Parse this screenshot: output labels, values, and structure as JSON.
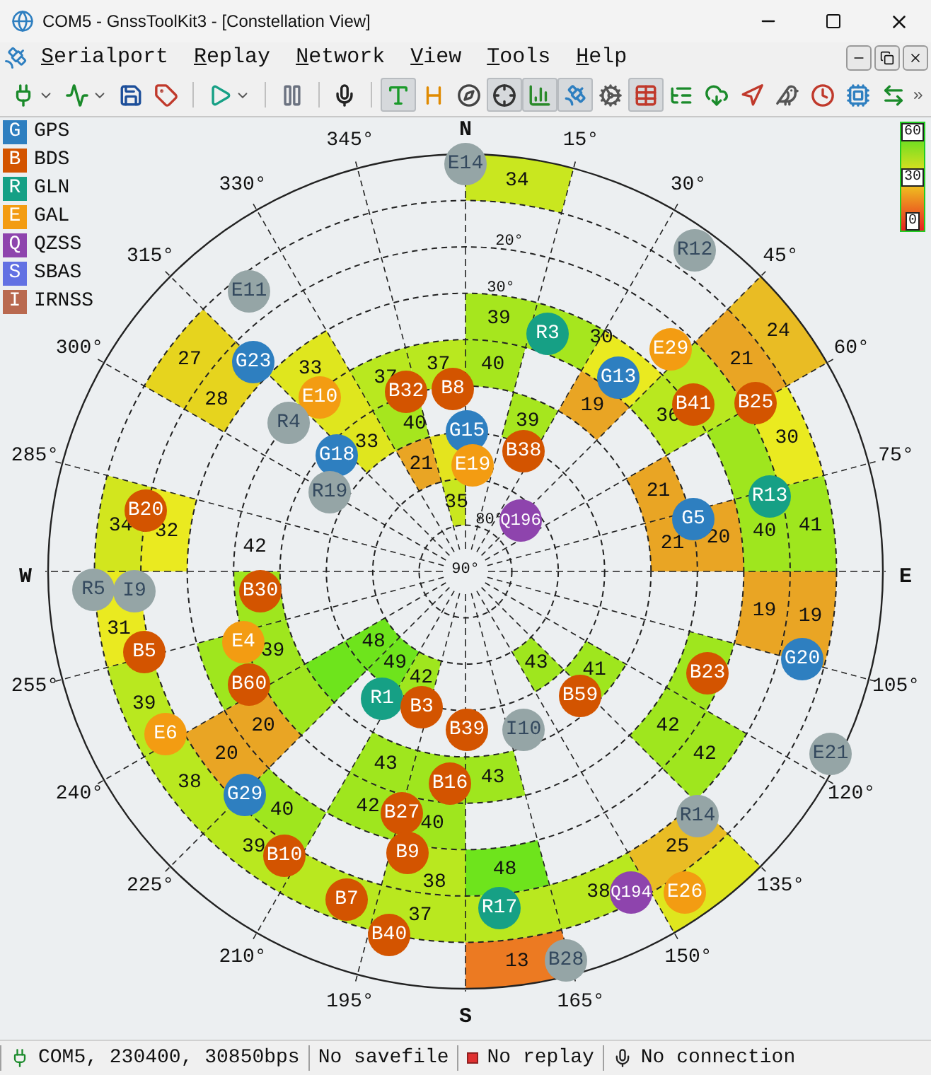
{
  "window": {
    "title": "COM5 - GnssToolKit3 - [Constellation View]"
  },
  "menu": [
    {
      "label": "Serialport"
    },
    {
      "label": "Replay"
    },
    {
      "label": "Network"
    },
    {
      "label": "View"
    },
    {
      "label": "Tools"
    },
    {
      "label": "Help"
    }
  ],
  "toolbar": [
    {
      "kind": "dropdown",
      "pressed": false
    },
    {
      "kind": "dropdown",
      "pressed": false
    },
    {
      "kind": "button",
      "pressed": false
    },
    {
      "kind": "button",
      "pressed": false
    },
    {
      "kind": "separator"
    },
    {
      "kind": "dropdown",
      "pressed": false
    },
    {
      "kind": "separator"
    },
    {
      "kind": "button",
      "pressed": false
    },
    {
      "kind": "separator"
    },
    {
      "kind": "button",
      "pressed": false
    },
    {
      "kind": "separator"
    },
    {
      "kind": "button",
      "pressed": true
    },
    {
      "kind": "button",
      "pressed": false
    },
    {
      "kind": "button",
      "pressed": false
    },
    {
      "kind": "button",
      "pressed": true
    },
    {
      "kind": "button",
      "pressed": true
    },
    {
      "kind": "button",
      "pressed": true
    },
    {
      "kind": "button",
      "pressed": false
    },
    {
      "kind": "button",
      "pressed": true
    },
    {
      "kind": "button",
      "pressed": false
    },
    {
      "kind": "button",
      "pressed": false
    },
    {
      "kind": "button",
      "pressed": false
    },
    {
      "kind": "button",
      "pressed": false
    },
    {
      "kind": "button",
      "pressed": false
    },
    {
      "kind": "button",
      "pressed": false
    },
    {
      "kind": "button",
      "pressed": false
    }
  ],
  "legend": [
    {
      "code": "G",
      "name": "GPS",
      "color": "#2e7fc0"
    },
    {
      "code": "B",
      "name": "BDS",
      "color": "#d35400"
    },
    {
      "code": "R",
      "name": "GLN",
      "color": "#16a085"
    },
    {
      "code": "E",
      "name": "GAL",
      "color": "#f39c12"
    },
    {
      "code": "Q",
      "name": "QZSS",
      "color": "#8e44ad"
    },
    {
      "code": "S",
      "name": "SBAS",
      "color": "#6271e3"
    },
    {
      "code": "I",
      "name": "IRNSS",
      "color": "#b9694f"
    }
  ],
  "color_scale": {
    "labels": [
      "60",
      "30",
      "0"
    ]
  },
  "sky_plot": {
    "compass": [
      "N",
      "E",
      "S",
      "W"
    ],
    "azimuth_labels": [
      "15°",
      "30°",
      "45°",
      "60°",
      "75°",
      "105°",
      "120°",
      "135°",
      "150°",
      "165°",
      "195°",
      "210°",
      "225°",
      "240°",
      "255°",
      "285°",
      "300°",
      "315°",
      "330°",
      "345°"
    ],
    "elevation_labels": [
      "20°",
      "30°",
      "80°",
      "90°"
    ],
    "cells": [
      {
        "value": "34",
        "color": "#c9e71f"
      },
      {
        "value": "27",
        "color": "#e6d41e"
      },
      {
        "value": "28",
        "color": "#e6d41e"
      },
      {
        "value": "33",
        "color": "#dfe61e"
      },
      {
        "color": "#dfe61e"
      },
      {
        "value": "33",
        "color": "#dfe61e"
      },
      {
        "value": "37",
        "color": "#b9e81f"
      },
      {
        "value": "37",
        "color": "#b9e81f"
      },
      {
        "value": "40",
        "color": "#a6e61e"
      },
      {
        "value": "21",
        "color": "#e9a524"
      },
      {
        "color": "#e4e41e"
      },
      {
        "value": "35",
        "color": "#c9e71f"
      },
      {
        "value": "39",
        "color": "#a6e61e"
      },
      {
        "value": "40",
        "color": "#a6e61e"
      },
      {
        "color": "#a6e61e"
      },
      {
        "value": "39",
        "color": "#a6e61e"
      },
      {
        "value": "30",
        "color": "#eaea20"
      },
      {
        "value": "19",
        "color": "#e9a524"
      },
      {
        "value": "36",
        "color": "#b9e81f"
      },
      {
        "color": "#b9e81f"
      },
      {
        "value": "24",
        "color": "#e9bc24"
      },
      {
        "value": "21",
        "color": "#e9a524"
      },
      {
        "value": "30",
        "color": "#eaea20"
      },
      {
        "color": "#9fe61e"
      },
      {
        "value": "21",
        "color": "#e9a524"
      },
      {
        "value": "21",
        "color": "#e9a524"
      },
      {
        "value": "20",
        "color": "#e9a524"
      },
      {
        "value": "40",
        "color": "#9fe61e"
      },
      {
        "value": "41",
        "color": "#9fe61e"
      },
      {
        "value": "19",
        "color": "#e9a524"
      },
      {
        "value": "19",
        "color": "#e9a524"
      },
      {
        "value": "43",
        "color": "#9fe61e"
      },
      {
        "value": "41",
        "color": "#9fe61e"
      },
      {
        "value": "42",
        "color": "#9fe61e"
      },
      {
        "value": "42",
        "color": "#9fe61e"
      },
      {
        "color": "#9fe61e"
      },
      {
        "value": "43",
        "color": "#9fe61e"
      },
      {
        "value": "48",
        "color": "#6ee41c"
      },
      {
        "color": "#b9e81f"
      },
      {
        "value": "38",
        "color": "#b9e81f"
      },
      {
        "value": "25",
        "color": "#e9bc24"
      },
      {
        "color": "#dfe61e"
      },
      {
        "value": "13",
        "color": "#ec7a22"
      },
      {
        "value": "43",
        "color": "#9fe61e"
      },
      {
        "value": "42",
        "color": "#9fe61e"
      },
      {
        "value": "40",
        "color": "#9fe61e"
      },
      {
        "value": "38",
        "color": "#b9e81f"
      },
      {
        "value": "37",
        "color": "#b9e81f"
      },
      {
        "value": "39",
        "color": "#b9e81f"
      },
      {
        "value": "40",
        "color": "#9fe61e"
      },
      {
        "value": "38",
        "color": "#b9e81f"
      },
      {
        "value": "20",
        "color": "#e9a524"
      },
      {
        "value": "20",
        "color": "#e9a524"
      },
      {
        "value": "39",
        "color": "#b9e81f"
      },
      {
        "value": "39",
        "color": "#9fe61e"
      },
      {
        "value": "42",
        "color": "#9fe61e"
      },
      {
        "value": "31",
        "color": "#eaea20"
      },
      {
        "value": "34",
        "color": "#d2e61e"
      },
      {
        "value": "32",
        "color": "#eaea20"
      },
      {
        "value": "48",
        "color": "#6ee41c"
      },
      {
        "value": "49",
        "color": "#6ee41c"
      },
      {
        "value": "42",
        "color": "#9fe61e"
      },
      {
        "color": "#6ee41c"
      },
      {
        "color": "#b9e81f"
      },
      {
        "color": "#9fe61e"
      },
      {
        "color": "#9fe61e"
      },
      {
        "color": "#9fe61e"
      }
    ],
    "satellites": [
      {
        "label": "E14",
        "color": "#95a5a6"
      },
      {
        "label": "E11",
        "color": "#95a5a6"
      },
      {
        "label": "R12",
        "color": "#95a5a6"
      },
      {
        "label": "G23",
        "color": "#2e7fc0"
      },
      {
        "label": "E10",
        "color": "#f39c12"
      },
      {
        "label": "R4",
        "color": "#95a5a6"
      },
      {
        "label": "G18",
        "color": "#2e7fc0"
      },
      {
        "label": "R19",
        "color": "#95a5a6"
      },
      {
        "label": "B20",
        "color": "#d35400"
      },
      {
        "label": "B32",
        "color": "#d35400"
      },
      {
        "label": "B8",
        "color": "#d35400"
      },
      {
        "label": "G15",
        "color": "#2e7fc0"
      },
      {
        "label": "E19",
        "color": "#f39c12"
      },
      {
        "label": "B38",
        "color": "#d35400"
      },
      {
        "label": "R3",
        "color": "#16a085"
      },
      {
        "label": "G13",
        "color": "#2e7fc0"
      },
      {
        "label": "E29",
        "color": "#f39c12"
      },
      {
        "label": "B41",
        "color": "#d35400"
      },
      {
        "label": "B25",
        "color": "#d35400"
      },
      {
        "label": "Q196",
        "color": "#8e44ad"
      },
      {
        "label": "G5",
        "color": "#2e7fc0"
      },
      {
        "label": "R13",
        "color": "#16a085"
      },
      {
        "label": "G20",
        "color": "#2e7fc0"
      },
      {
        "label": "B23",
        "color": "#d35400"
      },
      {
        "label": "B59",
        "color": "#d35400"
      },
      {
        "label": "B39",
        "color": "#d35400"
      },
      {
        "label": "I10",
        "color": "#95a5a6"
      },
      {
        "label": "E21",
        "color": "#95a5a6"
      },
      {
        "label": "R14",
        "color": "#95a5a6"
      },
      {
        "label": "Q194",
        "color": "#8e44ad"
      },
      {
        "label": "E26",
        "color": "#f39c12"
      },
      {
        "label": "R17",
        "color": "#16a085"
      },
      {
        "label": "B28",
        "color": "#95a5a6"
      },
      {
        "label": "B16",
        "color": "#d35400"
      },
      {
        "label": "B27",
        "color": "#d35400"
      },
      {
        "label": "B9",
        "color": "#d35400"
      },
      {
        "label": "B10",
        "color": "#d35400"
      },
      {
        "label": "B7",
        "color": "#d35400"
      },
      {
        "label": "B40",
        "color": "#d35400"
      },
      {
        "label": "G29",
        "color": "#2e7fc0"
      },
      {
        "label": "E6",
        "color": "#f39c12"
      },
      {
        "label": "B5",
        "color": "#d35400"
      },
      {
        "label": "E4",
        "color": "#f39c12"
      },
      {
        "label": "B60",
        "color": "#d35400"
      },
      {
        "label": "R5",
        "color": "#95a5a6"
      },
      {
        "label": "I9",
        "color": "#95a5a6"
      },
      {
        "label": "B30",
        "color": "#d35400"
      },
      {
        "label": "R1",
        "color": "#16a085"
      },
      {
        "label": "B3",
        "color": "#d35400"
      }
    ]
  },
  "status_bar": [
    {
      "kind": "port",
      "text": "COM5, 230400, 30850bps"
    },
    {
      "kind": "file",
      "text": "No savefile"
    },
    {
      "kind": "replay",
      "text": "No replay"
    },
    {
      "kind": "network",
      "text": "No connection"
    }
  ]
}
